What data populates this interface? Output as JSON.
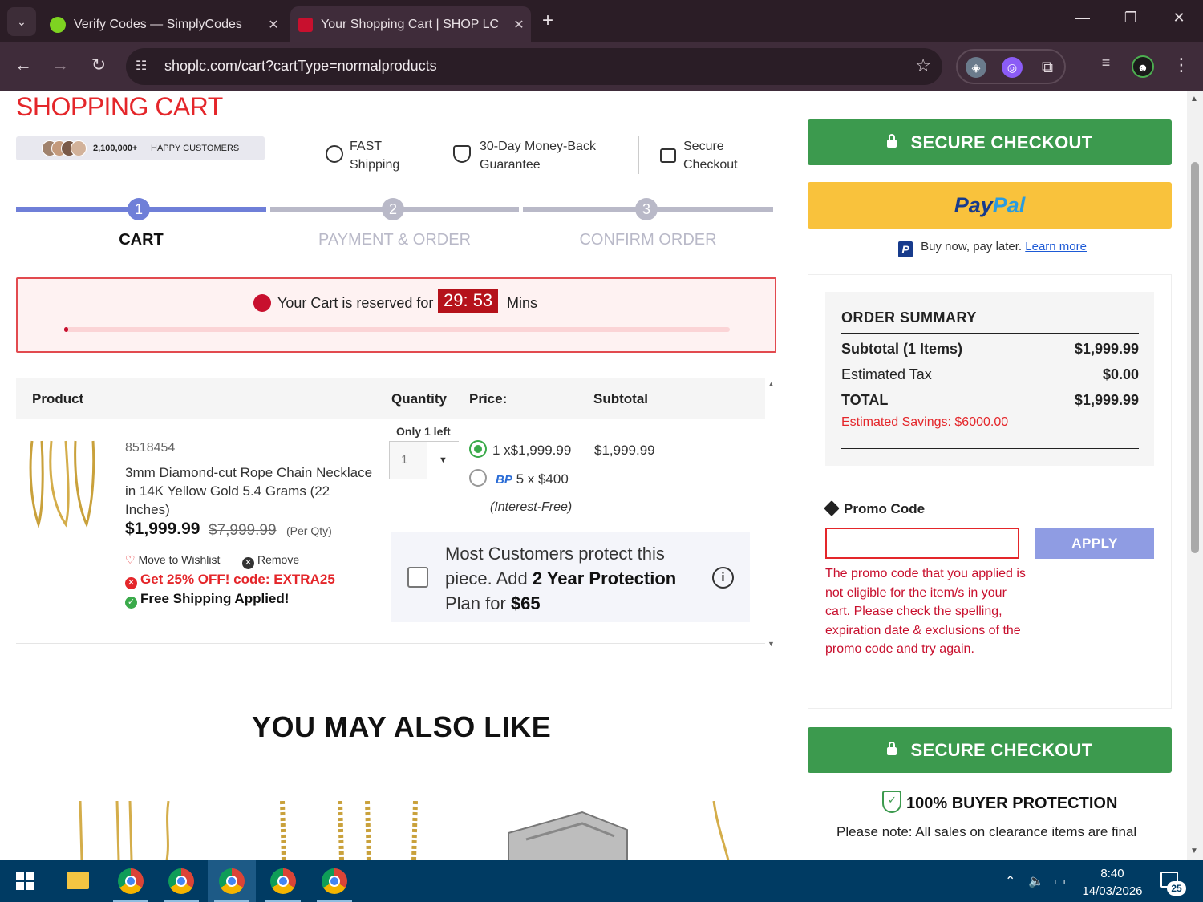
{
  "browser": {
    "tabs": [
      {
        "title": "Verify Codes — SimplyCodes",
        "close": "✕"
      },
      {
        "title": "Your Shopping Cart | SHOP LC",
        "close": "✕"
      }
    ],
    "new_tab": "+",
    "url": "shoplc.com/cart?cartType=normalproducts",
    "window_controls": {
      "minimize": "—",
      "restore": "❐",
      "close": "✕"
    }
  },
  "header": {
    "title": "SHOPPING CART",
    "happy_count": "2,100,000+",
    "happy_label": "HAPPY CUSTOMERS",
    "features": [
      {
        "line1": "FAST",
        "line2": "Shipping"
      },
      {
        "line1": "30-Day Money-Back",
        "line2": "Guarantee"
      },
      {
        "line1": "Secure",
        "line2": "Checkout"
      }
    ]
  },
  "steps": [
    {
      "num": "1",
      "label": "CART",
      "active": true
    },
    {
      "num": "2",
      "label": "PAYMENT & ORDER",
      "active": false
    },
    {
      "num": "3",
      "label": "CONFIRM ORDER",
      "active": false
    }
  ],
  "reserve": {
    "message": "Your Cart is reserved for",
    "timer": "29: 53",
    "unit": "Mins",
    "progress": 0.006
  },
  "cart": {
    "headers": {
      "product": "Product",
      "quantity": "Quantity",
      "price": "Price:",
      "subtotal": "Subtotal"
    },
    "item": {
      "sku": "8518454",
      "name": "3mm Diamond-cut Rope Chain Necklace in 14K Yellow Gold 5.4 Grams (22 Inches)",
      "price": "$1,999.99",
      "original_price": "$7,999.99",
      "per_qty": "(Per Qty)",
      "wishlist": "Move to Wishlist",
      "remove": "Remove",
      "offer": "Get 25% OFF! code: EXTRA25",
      "free_shipping": "Free Shipping Applied!",
      "only_left": "Only 1 left",
      "quantity": "1",
      "option1": "1 x$1,999.99",
      "option2_brand": "BP",
      "option2": "5 x $400",
      "interest": "(Interest-Free)",
      "subtotal": "$1,999.99"
    },
    "protection": {
      "line1": "Most Customers protect this piece. Add ",
      "bold1": "2 Year Protection",
      "line2": " Plan for ",
      "bold2": "$65"
    }
  },
  "may_like": "YOU MAY ALSO LIKE",
  "sidebar": {
    "checkout_label": "SECURE CHECKOUT",
    "paypal_1": "Pay",
    "paypal_2": "Pal",
    "paylater_text": "Buy now, pay later.",
    "paylater_link": "Learn more",
    "summary": {
      "title": "ORDER SUMMARY",
      "subtotal_label": "Subtotal (1 Items)",
      "subtotal_value": "$1,999.99",
      "tax_label": "Estimated Tax",
      "tax_value": "$0.00",
      "total_label": "TOTAL",
      "total_value": "$1,999.99",
      "savings_label": "Estimated Savings:",
      "savings_value": "$6000.00"
    },
    "promo": {
      "label": "Promo Code",
      "value": "",
      "apply": "APPLY",
      "error": "The promo code that you applied is not eligible for the item/s in your cart. Please check the spelling, expiration date & exclusions of the promo code and try again."
    },
    "buyer_protection": "100% BUYER PROTECTION",
    "note": "Please note: All sales on clearance items are final"
  },
  "taskbar": {
    "time": "8:40",
    "date": "14/03/2026",
    "notifications": "25"
  },
  "colors": {
    "accent_red": "#e4262a",
    "step_active": "#6f7fd8",
    "step_inactive": "#b9b9c8",
    "checkout_green": "#3c9a4e",
    "paypal_yellow": "#f9c23c",
    "apply_blue": "#8f9ce3"
  }
}
